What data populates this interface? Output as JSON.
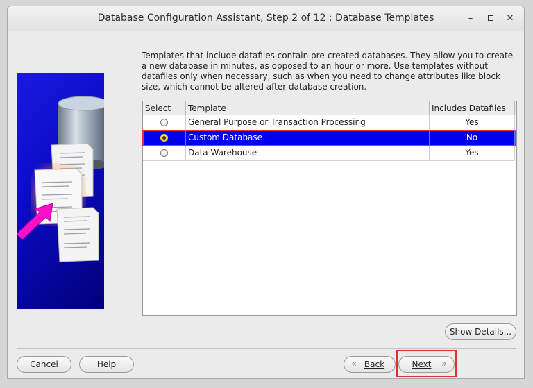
{
  "window": {
    "title": "Database Configuration Assistant, Step 2 of 12 : Database Templates",
    "controls": {
      "minimize": "–",
      "close": "✕"
    }
  },
  "description": "Templates that include datafiles contain pre-created databases. They allow you to create a new database in minutes, as opposed to an hour or more. Use templates without datafiles only when necessary, such as when you need to change attributes like block size, which cannot be altered after database creation.",
  "table": {
    "headers": [
      "Select",
      "Template",
      "Includes Datafiles"
    ],
    "rows": [
      {
        "template": "General Purpose or Transaction Processing",
        "includes": "Yes",
        "selected": false
      },
      {
        "template": "Custom Database",
        "includes": "No",
        "selected": true
      },
      {
        "template": "Data Warehouse",
        "includes": "Yes",
        "selected": false
      }
    ]
  },
  "buttons": {
    "show_details": "Show Details...",
    "cancel": "Cancel",
    "help": "Help",
    "back": "Back",
    "next": "Next"
  },
  "colors": {
    "selection": "#0000ee",
    "highlight_outline": "#e03030",
    "illustration_bg": "#0c0cc8",
    "arrow_magenta": "#ff10c8"
  }
}
